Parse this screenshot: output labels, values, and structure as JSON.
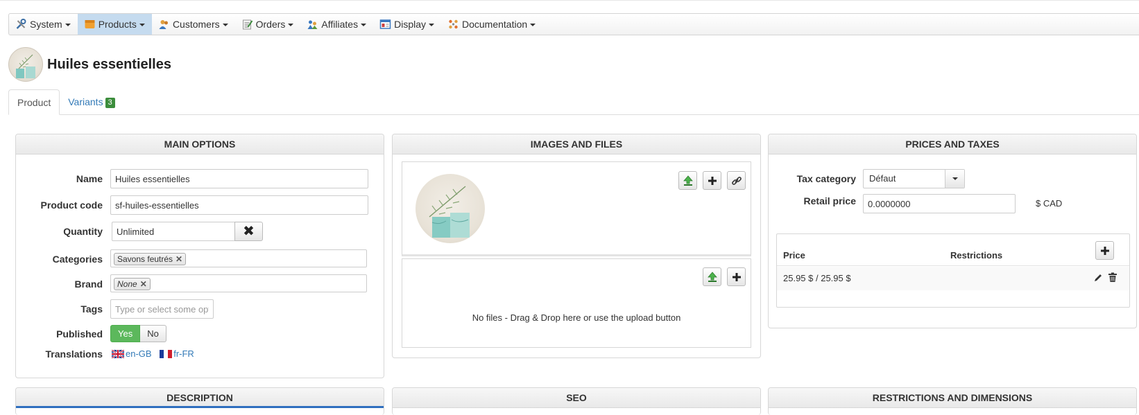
{
  "nav": {
    "items": [
      {
        "label": "System",
        "icon": "tools-icon"
      },
      {
        "label": "Products",
        "icon": "box-icon",
        "active": true
      },
      {
        "label": "Customers",
        "icon": "users-icon"
      },
      {
        "label": "Orders",
        "icon": "clipboard-icon"
      },
      {
        "label": "Affiliates",
        "icon": "affiliates-icon"
      },
      {
        "label": "Display",
        "icon": "display-icon"
      },
      {
        "label": "Documentation",
        "icon": "docs-icon"
      }
    ]
  },
  "header": {
    "title": "Huiles essentielles"
  },
  "tabs": {
    "product": "Product",
    "variants": "Variants",
    "variants_count": "3"
  },
  "main_options": {
    "title": "MAIN OPTIONS",
    "name_label": "Name",
    "name_value": "Huiles essentielles",
    "code_label": "Product code",
    "code_value": "sf-huiles-essentielles",
    "quantity_label": "Quantity",
    "quantity_value": "Unlimited",
    "categories_label": "Categories",
    "category_chip": "Savons feutrés",
    "brand_label": "Brand",
    "brand_chip": "None",
    "tags_label": "Tags",
    "tags_placeholder": "Type or select some options",
    "published_label": "Published",
    "published_yes": "Yes",
    "published_no": "No",
    "translations_label": "Translations",
    "lang_en": "en-GB",
    "lang_fr": "fr-FR"
  },
  "images": {
    "title": "IMAGES AND FILES",
    "no_files": "No files - Drag & Drop here or use the upload button"
  },
  "prices": {
    "title": "PRICES AND TAXES",
    "tax_label": "Tax category",
    "tax_value": "Défaut",
    "retail_label": "Retail price",
    "retail_value": "0.0000000",
    "currency": "$ CAD",
    "col_price": "Price",
    "col_restrictions": "Restrictions",
    "row_price": "25.95 $ / 25.95 $"
  },
  "bottom": {
    "description": "DESCRIPTION",
    "seo": "SEO",
    "restrictions": "RESTRICTIONS AND DIMENSIONS"
  }
}
